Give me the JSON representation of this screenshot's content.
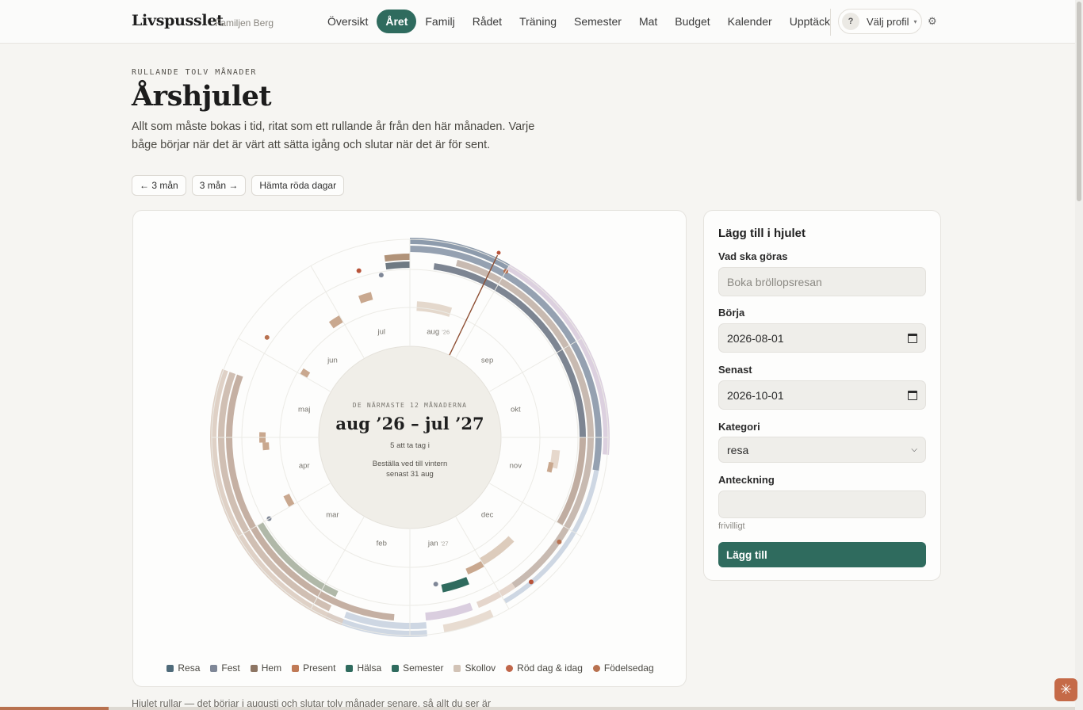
{
  "app": {
    "brand": "Livspusslet",
    "family": "Familjen Berg"
  },
  "nav": [
    {
      "label": "Översikt",
      "active": false
    },
    {
      "label": "Året",
      "active": true
    },
    {
      "label": "Familj",
      "active": false
    },
    {
      "label": "Rådet",
      "active": false
    },
    {
      "label": "Träning",
      "active": false
    },
    {
      "label": "Semester",
      "active": false
    },
    {
      "label": "Mat",
      "active": false
    },
    {
      "label": "Budget",
      "active": false
    },
    {
      "label": "Kalender",
      "active": false
    },
    {
      "label": "Upptäck",
      "active": false
    }
  ],
  "profile": {
    "badge": "?",
    "label": "Välj profil",
    "caret": "▾"
  },
  "settings_icon": "gear-icon",
  "hero": {
    "eyebrow": "RULLANDE TOLV MÅNADER",
    "title": "Årshjulet",
    "intro": "Allt som måste bokas i tid, ritat som ett rullande år från den här månaden. Varje båge börjar när det är värt att sätta igång och slutar när det är för sent."
  },
  "controls": {
    "back": "← 3 mån",
    "forward": "3 mån →",
    "holidays": "Hämta röda dagar"
  },
  "wheel": {
    "center_eyebrow": "DE NÄRMASTE 12 MÅNADERNA",
    "center_title": "aug ’26 – jul ’27",
    "center_count": "5 att ta tag i",
    "center_next_1": "Beställa ved till vintern",
    "center_next_2": "senast 31 aug",
    "months": [
      {
        "m": "aug",
        "y": "’26"
      },
      {
        "m": "sep",
        "y": ""
      },
      {
        "m": "okt",
        "y": ""
      },
      {
        "m": "nov",
        "y": ""
      },
      {
        "m": "dec",
        "y": ""
      },
      {
        "m": "jan",
        "y": "’27"
      },
      {
        "m": "feb",
        "y": ""
      },
      {
        "m": "mar",
        "y": ""
      },
      {
        "m": "apr",
        "y": ""
      },
      {
        "m": "maj",
        "y": ""
      },
      {
        "m": "jun",
        "y": ""
      },
      {
        "m": "jul",
        "y": ""
      }
    ]
  },
  "legend": [
    {
      "label": "Resa",
      "color": "#4f6b7a"
    },
    {
      "label": "Fest",
      "color": "#7f8797"
    },
    {
      "label": "Hem",
      "color": "#8d7563"
    },
    {
      "label": "Present",
      "color": "#c07a56"
    },
    {
      "label": "Hälsa",
      "color": "#2f6b5e"
    },
    {
      "label": "Semester",
      "color": "#2f6b5e"
    },
    {
      "label": "Skollov",
      "color": "#d2c3b6"
    },
    {
      "label": "Röd dag & idag",
      "color": "#c0664a"
    },
    {
      "label": "Födelsedag",
      "color": "#b8714f"
    }
  ],
  "form": {
    "title": "Lägg till i hjulet",
    "what_label": "Vad ska göras",
    "what_placeholder": "Boka bröllopsresan",
    "start_label": "Börja",
    "start_value": "2026-08-01",
    "latest_label": "Senast",
    "latest_value": "2026-10-01",
    "category_label": "Kategori",
    "category_value": "resa",
    "note_label": "Anteckning",
    "note_hint": "frivilligt",
    "submit": "Lägg till"
  },
  "footnote": "Hjulet rullar — det börjar i augusti och slutar tolv månader senare, så allt du ser är"
}
